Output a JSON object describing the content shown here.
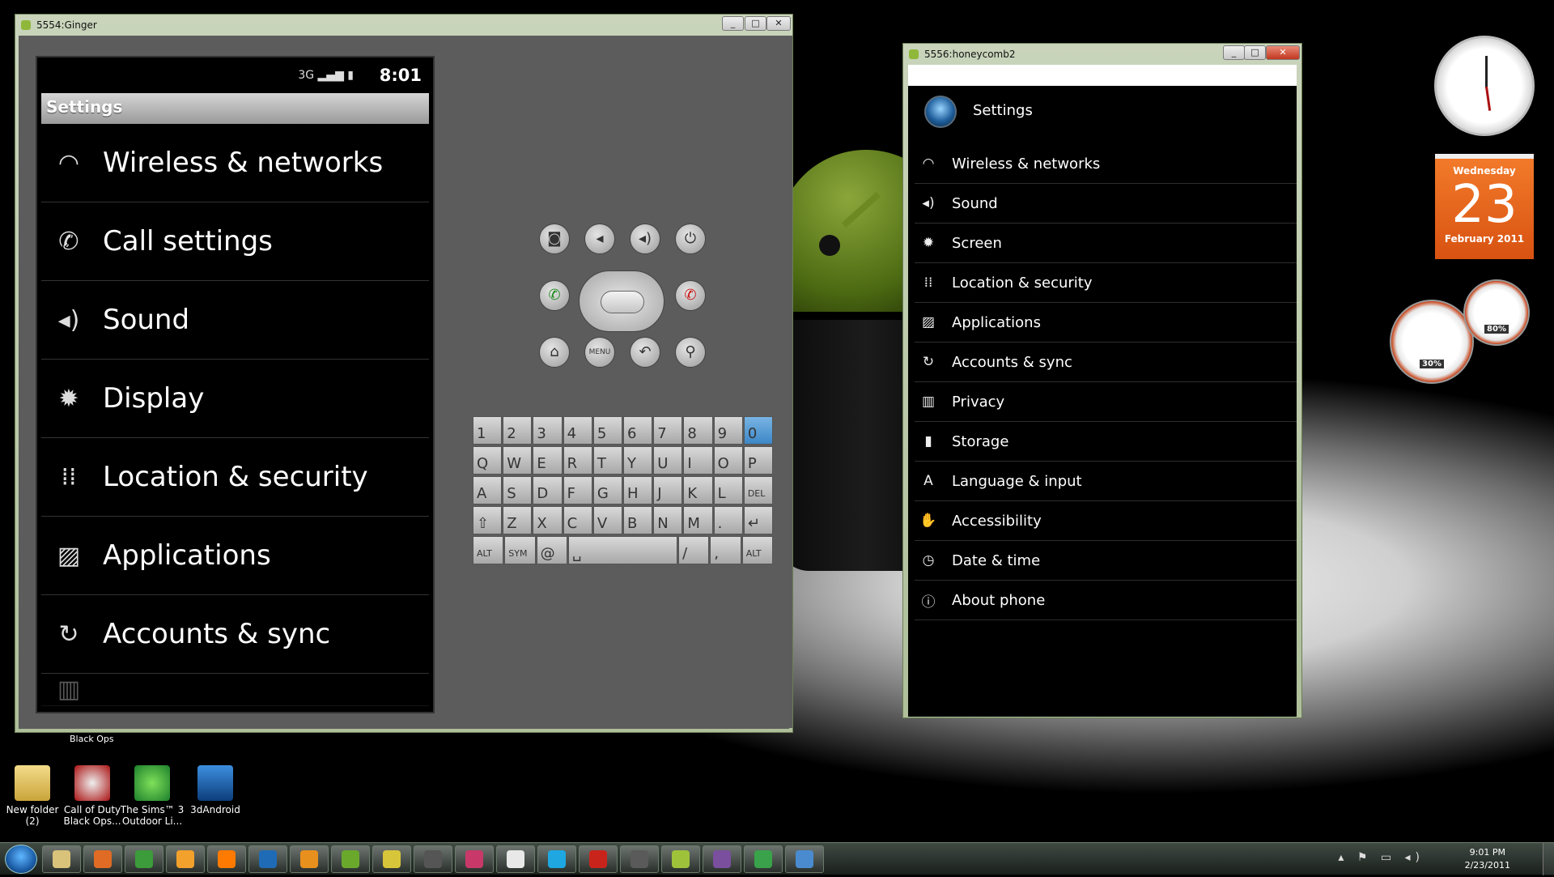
{
  "ginger_window": {
    "title": "5554:Ginger",
    "status_signal": "3G",
    "time": "8:01",
    "header": "Settings",
    "items": [
      {
        "label": "Wireless & networks",
        "icon": "wifi-icon"
      },
      {
        "label": "Call settings",
        "icon": "phone-icon"
      },
      {
        "label": "Sound",
        "icon": "speaker-icon"
      },
      {
        "label": "Display",
        "icon": "brightness-icon"
      },
      {
        "label": "Location & security",
        "icon": "grid-icon"
      },
      {
        "label": "Applications",
        "icon": "applications-icon"
      },
      {
        "label": "Accounts & sync",
        "icon": "sync-icon"
      }
    ],
    "hw_buttons": [
      "camera",
      "volume-down",
      "volume-up",
      "power",
      "call",
      "end-call",
      "home",
      "MENU",
      "back",
      "search"
    ],
    "keyboard": {
      "row1": [
        "1",
        "2",
        "3",
        "4",
        "5",
        "6",
        "7",
        "8",
        "9",
        "0"
      ],
      "row2": [
        "Q",
        "W",
        "E",
        "R",
        "T",
        "Y",
        "U",
        "I",
        "O",
        "P"
      ],
      "row3": [
        "A",
        "S",
        "D",
        "F",
        "G",
        "H",
        "J",
        "K",
        "L",
        "DEL"
      ],
      "row4": [
        "⇧",
        "Z",
        "X",
        "C",
        "V",
        "B",
        "N",
        "M",
        ".",
        "↵"
      ],
      "row5": [
        "ALT",
        "SYM",
        "@",
        "␣",
        "/",
        ",",
        "ALT"
      ]
    }
  },
  "honeycomb_window": {
    "title": "5556:honeycomb2",
    "header": "Settings",
    "items": [
      {
        "label": "Wireless & networks",
        "icon": "wifi-icon"
      },
      {
        "label": "Sound",
        "icon": "speaker-icon"
      },
      {
        "label": "Screen",
        "icon": "brightness-icon"
      },
      {
        "label": "Location & security",
        "icon": "grid-icon"
      },
      {
        "label": "Applications",
        "icon": "applications-icon"
      },
      {
        "label": "Accounts & sync",
        "icon": "sync-icon"
      },
      {
        "label": "Privacy",
        "icon": "privacy-icon"
      },
      {
        "label": "Storage",
        "icon": "storage-icon"
      },
      {
        "label": "Language & input",
        "icon": "language-icon"
      },
      {
        "label": "Accessibility",
        "icon": "hand-icon"
      },
      {
        "label": "Date & time",
        "icon": "clock-icon"
      },
      {
        "label": "About phone",
        "icon": "info-icon"
      }
    ]
  },
  "gadgets": {
    "calendar_day": "Wednesday",
    "calendar_date": "23",
    "calendar_month": "February 2011",
    "cpu_percent": "30%",
    "mem_percent": "80%"
  },
  "desktop_icons": [
    {
      "label": "New folder (2)"
    },
    {
      "label": "Call of Duty Black Ops..."
    },
    {
      "label": "The Sims™ 3 Outdoor Li..."
    },
    {
      "label": "3dAndroid"
    }
  ],
  "desktop_partial_label": "Black Ops",
  "taskbar": {
    "apps": [
      "Explorer",
      "Firefox",
      "Chrome",
      "Media Player",
      "VLC",
      "Ps",
      "Ai",
      "Dw",
      "Fw",
      "Steam",
      "Id",
      "Java",
      "Skype",
      "Acrobat",
      "JavaEE",
      "Android",
      "WinRAR",
      "uTorrent",
      "Paint"
    ],
    "time": "9:01 PM",
    "date": "2/23/2011"
  }
}
